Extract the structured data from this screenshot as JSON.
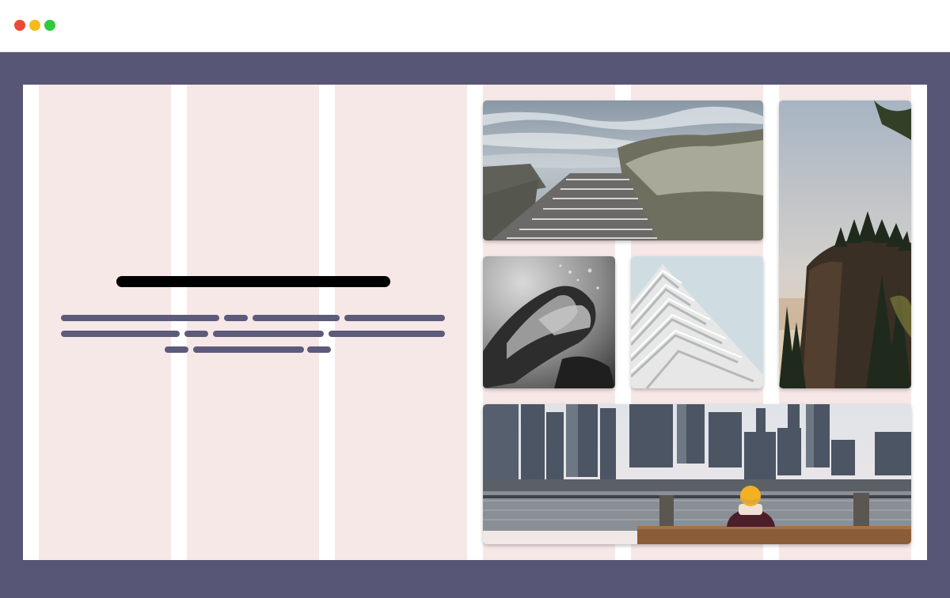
{
  "window": {
    "controls": [
      "close",
      "minimize",
      "maximize"
    ],
    "colors": {
      "close": "#ea4b37",
      "minimize": "#f3bb1c",
      "maximize": "#30c93f",
      "frame": "#585676",
      "grid_column": "#f7e8e8",
      "headline_bar": "#000000",
      "text_bar": "#5d5b7b"
    }
  },
  "layout_grid": {
    "columns": 6,
    "column_fill": "pink"
  },
  "hero": {
    "headline": "",
    "body_lines": 3
  },
  "gallery": {
    "photos": [
      {
        "subject": "boardwalk-to-sea-photo"
      },
      {
        "subject": "underwater-swimmer-photo"
      },
      {
        "subject": "white-building-facade-photo"
      },
      {
        "subject": "cliff-with-pine-trees-photo"
      },
      {
        "subject": "city-skyline-waterfront-photo"
      }
    ]
  }
}
